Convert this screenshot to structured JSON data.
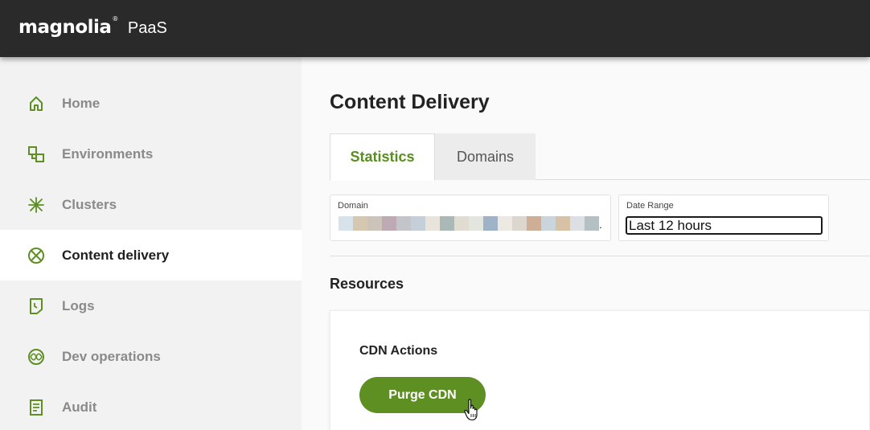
{
  "header": {
    "logo_text": "magnolia",
    "logo_mark": "®",
    "product": "PaaS"
  },
  "sidebar": {
    "items": [
      {
        "label": "Home",
        "icon": "home-icon"
      },
      {
        "label": "Environments",
        "icon": "environments-icon"
      },
      {
        "label": "Clusters",
        "icon": "clusters-icon"
      },
      {
        "label": "Content delivery",
        "icon": "content-delivery-icon",
        "active": true
      },
      {
        "label": "Logs",
        "icon": "logs-icon"
      },
      {
        "label": "Dev operations",
        "icon": "dev-operations-icon"
      },
      {
        "label": "Audit",
        "icon": "audit-icon"
      }
    ]
  },
  "main": {
    "title": "Content Delivery",
    "tabs": [
      {
        "label": "Statistics",
        "active": true
      },
      {
        "label": "Domains",
        "active": false
      }
    ],
    "filters": {
      "domain_label": "Domain",
      "domain_value_suffix": ".",
      "date_range_label": "Date Range",
      "date_range_value": "Last 12 hours"
    },
    "resources_title": "Resources",
    "cdn_actions_title": "CDN Actions",
    "purge_button_label": "Purge CDN"
  },
  "colors": {
    "accent": "#5d8f22",
    "topbar": "#2a2a2a",
    "sidebar_bg": "#f2f2f2"
  }
}
